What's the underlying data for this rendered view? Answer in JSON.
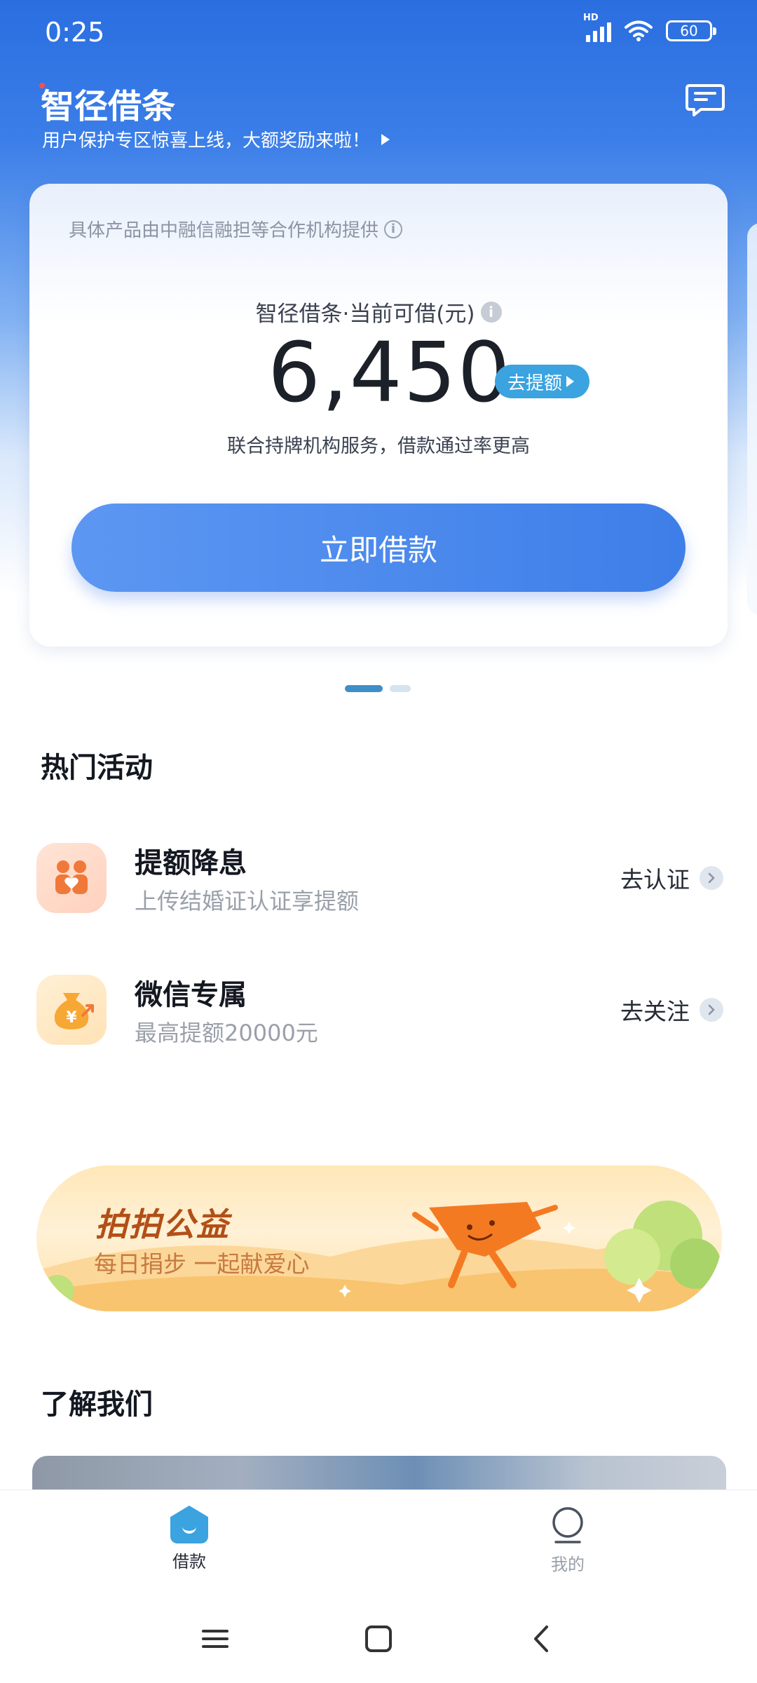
{
  "status_bar": {
    "time": "0:25",
    "network": "HD",
    "battery": "60"
  },
  "header": {
    "app_title": "智径借条",
    "announcement": "用户保护专区惊喜上线，大额奖励来啦！",
    "message_icon": "message-icon"
  },
  "credit_card": {
    "provider_note": "具体产品由中融信融担等合作机构提供",
    "limit_label": "智径借条·当前可借(元)",
    "amount": "6,450",
    "raise_label": "去提额",
    "note": "联合持牌机构服务，借款通过率更高",
    "borrow_button": "立即借款"
  },
  "carousel": {
    "active_index": 0,
    "count": 2
  },
  "hot_activities": {
    "title": "热门活动",
    "items": [
      {
        "title": "提额降息",
        "subtitle": "上传结婚证认证享提额",
        "action": "去认证",
        "icon": "couple-icon"
      },
      {
        "title": "微信专属",
        "subtitle": "最高提额20000元",
        "action": "去关注",
        "icon": "money-bag-icon"
      }
    ]
  },
  "charity_banner": {
    "title": "拍拍公益",
    "subtitle": "每日捐步 一起献爱心"
  },
  "about": {
    "title": "了解我们"
  },
  "tab_bar": {
    "tabs": [
      {
        "label": "借款",
        "icon": "home-icon",
        "active": true
      },
      {
        "label": "我的",
        "icon": "profile-icon",
        "active": false
      }
    ]
  },
  "colors": {
    "brand_blue": "#3e7ee8",
    "accent_blue": "#3aa3e0",
    "charity_text": "#b24f17"
  }
}
